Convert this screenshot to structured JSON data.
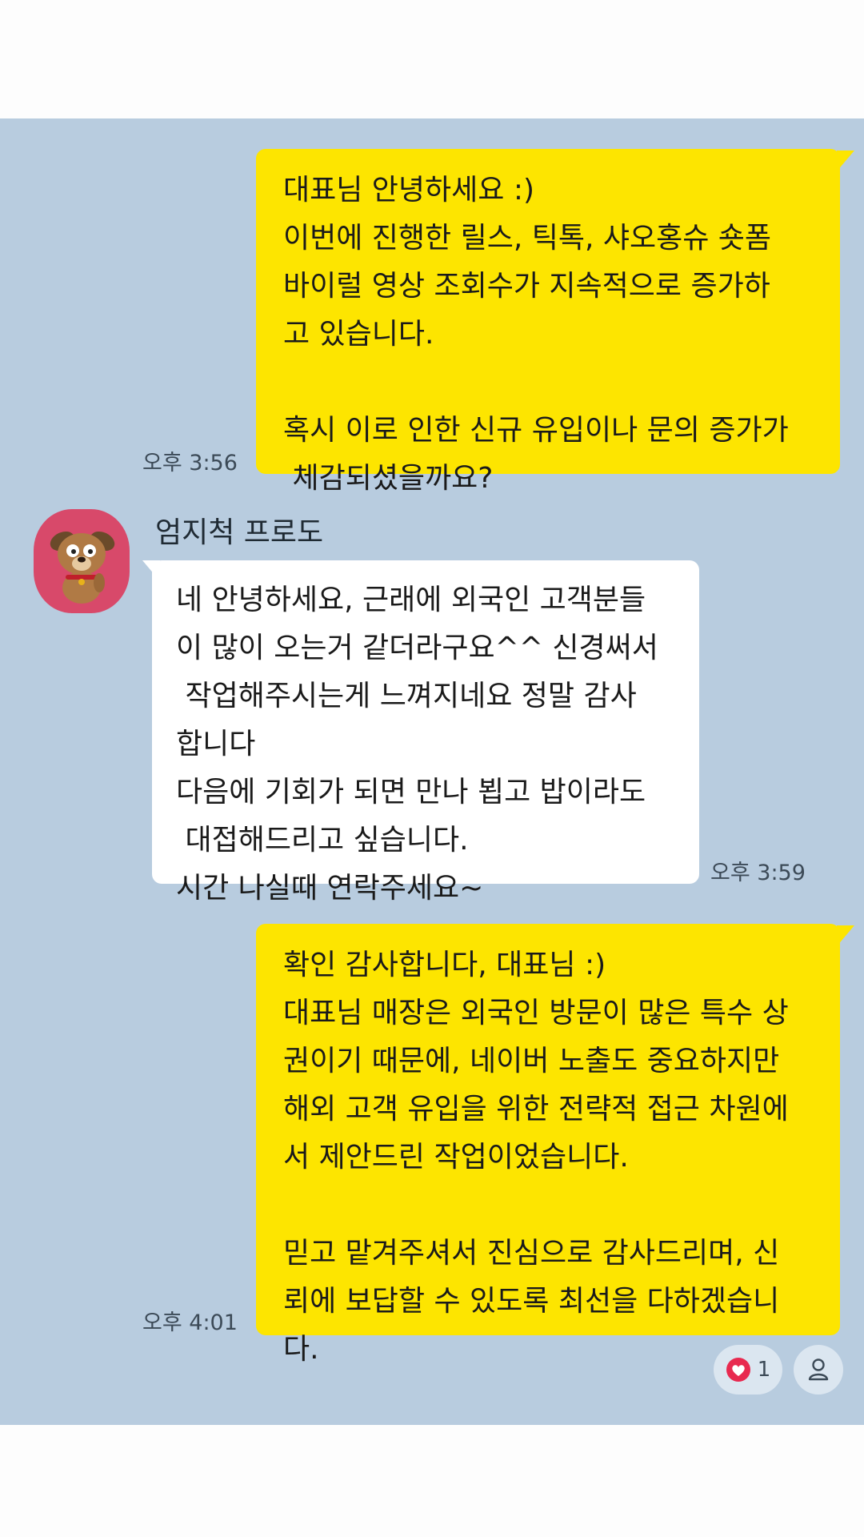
{
  "chat": {
    "messages": [
      {
        "sender": "me",
        "text": "대표님 안녕하세요 :)\n이번에 진행한 릴스, 틱톡, 샤오홍슈 숏폼\n바이럴 영상 조회수가 지속적으로 증가하\n고 있습니다.\n\n혹시 이로 인한 신규 유입이나 문의 증가가\n 체감되셨을까요?",
        "time": "오후 3:56"
      },
      {
        "sender": "them",
        "sender_name": "엄지척 프로도",
        "avatar_icon": "frodo-dog-avatar",
        "text": "네 안녕하세요, 근래에 외국인 고객분들\n이 많이 오는거 같더라구요^^ 신경써서\n 작업해주시는게 느껴지네요 정말 감사\n합니다\n다음에 기회가 되면 만나 뵙고 밥이라도\n 대접해드리고 싶습니다.\n시간 나실때 연락주세요~",
        "time": "오후 3:59"
      },
      {
        "sender": "me",
        "text": "확인 감사합니다, 대표님 :)\n대표님 매장은 외국인 방문이 많은 특수 상\n권이기 때문에, 네이버 노출도 중요하지만\n해외 고객 유입을 위한 전략적 접근 차원에\n서 제안드린 작업이었습니다.\n\n믿고 맡겨주셔서 진심으로 감사드리며, 신\n뢰에 보답할 수 있도록 최선을 다하겠습니\n다.",
        "time": "오후 4:01"
      }
    ],
    "reactions": {
      "heart_icon": "heart-icon",
      "heart_count": "1",
      "person_icon": "person-icon"
    }
  },
  "colors": {
    "chat_bg": "#b8ccdf",
    "my_bubble": "#fde500",
    "their_bubble": "#ffffff",
    "heart": "#e8294f"
  }
}
